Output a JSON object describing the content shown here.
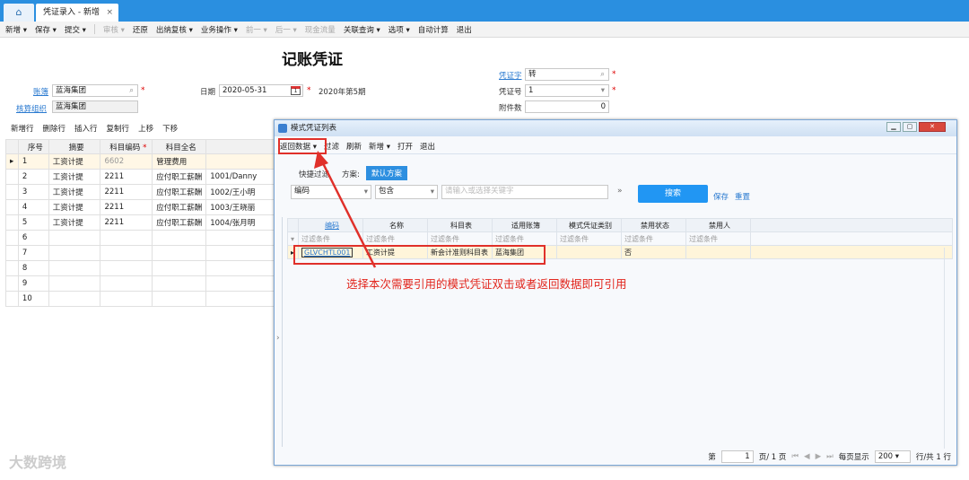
{
  "tabs": {
    "home_icon": "home-icon",
    "active": "凭证录入 - 新增",
    "close": "×"
  },
  "toolbar": [
    "新增 ▾",
    "保存 ▾",
    "提交 ▾",
    "审核 ▾",
    "还原",
    "出纳复核 ▾",
    "业务操作 ▾",
    "前一 ▾",
    "后一 ▾",
    "现金流量",
    "关联查询 ▾",
    "选项 ▾",
    "自动计算",
    "退出"
  ],
  "header": {
    "title": "记账凭证",
    "book_label": "账簿",
    "book_value": "蓝海集团",
    "org_label": "核算组织",
    "org_value": "蓝海集团",
    "date_label": "日期",
    "date_value": "2020-05-31",
    "period": "2020年第5期",
    "word_label": "凭证字",
    "word_value": "转",
    "no_label": "凭证号",
    "no_value": "1",
    "attach_label": "附件数",
    "attach_value": "0"
  },
  "row_tools": [
    "新增行",
    "删除行",
    "插入行",
    "复制行",
    "上移",
    "下移"
  ],
  "main_table": {
    "headers": [
      "序号",
      "摘要",
      "科目编码",
      "科目全名"
    ],
    "rows": [
      {
        "no": "1",
        "summary": "工资计提",
        "code": "6602",
        "name": "管理费用",
        "extra": ""
      },
      {
        "no": "2",
        "summary": "工资计提",
        "code": "2211",
        "name": "应付职工薪酬",
        "extra": "1001/Danny"
      },
      {
        "no": "3",
        "summary": "工资计提",
        "code": "2211",
        "name": "应付职工薪酬",
        "extra": "1002/王小明"
      },
      {
        "no": "4",
        "summary": "工资计提",
        "code": "2211",
        "name": "应付职工薪酬",
        "extra": "1003/王晓丽"
      },
      {
        "no": "5",
        "summary": "工资计提",
        "code": "2211",
        "name": "应付职工薪酬",
        "extra": "1004/张月明"
      },
      {
        "no": "6",
        "summary": "",
        "code": "",
        "name": "",
        "extra": ""
      },
      {
        "no": "7",
        "summary": "",
        "code": "",
        "name": "",
        "extra": ""
      },
      {
        "no": "8",
        "summary": "",
        "code": "",
        "name": "",
        "extra": ""
      },
      {
        "no": "9",
        "summary": "",
        "code": "",
        "name": "",
        "extra": ""
      },
      {
        "no": "10",
        "summary": "",
        "code": "",
        "name": "",
        "extra": ""
      }
    ]
  },
  "dialog": {
    "title": "模式凭证列表",
    "toolbar": [
      "返回数据 ▾",
      "过滤",
      "刷新",
      "新增 ▾",
      "打开",
      "退出"
    ],
    "quick_filter": "快捷过滤",
    "scheme_label": "方案:",
    "scheme_value": "默认方案",
    "field_select": "编码",
    "op_select": "包含",
    "keyword_placeholder": "请输入或选择关键字",
    "search_btn": "搜索",
    "save_link": "保存",
    "reset_link": "重置",
    "headers": [
      "编码",
      "名称",
      "科目表",
      "适用账簿",
      "模式凭证类别",
      "禁用状态",
      "禁用人"
    ],
    "filter_text": "过滤条件",
    "row": {
      "code": "GLVCHTL001",
      "name": "工资计提",
      "chart": "新会计准则科目表",
      "book": "蓝海集团",
      "category": "",
      "disabled": "否",
      "disabled_by": ""
    },
    "footer": {
      "page_prefix": "第",
      "page_value": "1",
      "page_suffix": "页/ 1 页",
      "per_page_label": "每页显示",
      "per_page": "200",
      "total": "行/共 1 行"
    }
  },
  "annotation": "选择本次需要引用的模式凭证双击或者返回数据即可引用",
  "watermark": "大数跨境",
  "colors": {
    "accent": "#2a8fe0",
    "highlight": "#e0302a"
  }
}
